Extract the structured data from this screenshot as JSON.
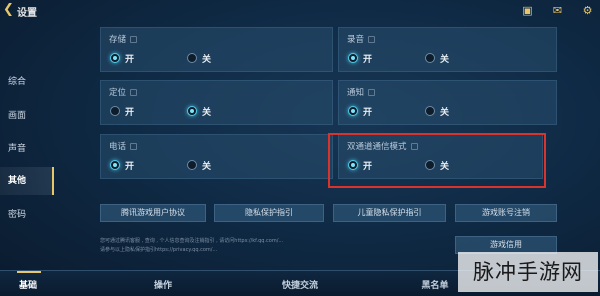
{
  "header": {
    "back_icon": "chevron-left-icon",
    "title": "设置",
    "right_icons": [
      "calendar-check-icon",
      "mail-icon",
      "gear-icon"
    ]
  },
  "nav": {
    "items": [
      {
        "label": "综合",
        "active": false
      },
      {
        "label": "画面",
        "active": false
      },
      {
        "label": "声音",
        "active": false
      },
      {
        "label": "其他",
        "active": true
      },
      {
        "label": "密码",
        "active": false
      }
    ]
  },
  "panels": [
    {
      "title": "存储",
      "on_label": "开",
      "off_label": "关",
      "selected": "on"
    },
    {
      "title": "录音",
      "on_label": "开",
      "off_label": "关",
      "selected": "on"
    },
    {
      "title": "定位",
      "on_label": "开",
      "off_label": "关",
      "selected": "off"
    },
    {
      "title": "通知",
      "on_label": "开",
      "off_label": "关",
      "selected": "on"
    },
    {
      "title": "电话",
      "on_label": "开",
      "off_label": "关",
      "selected": "on"
    },
    {
      "title": "双通道通信模式",
      "on_label": "开",
      "off_label": "关",
      "selected": "on"
    }
  ],
  "links": [
    "腾讯游戏用户协议",
    "隐私保护指引",
    "儿童隐私保护指引",
    "游戏账号注销"
  ],
  "notes": [
    "您可通过腾讯客服 , 查询 , 个人信息查询及注销指引 , 请访问https://kf.qq.com/...",
    "请参与以上隐私保护指引https://privacy.qq.com/..."
  ],
  "credit_label": "游戏信用",
  "tabs": [
    {
      "label": "基础",
      "active": true
    },
    {
      "label": "操作",
      "active": false
    },
    {
      "label": "快捷交流",
      "active": false
    },
    {
      "label": "黑名单",
      "active": false
    }
  ],
  "watermark": "脉冲手游网",
  "colors": {
    "accent": "#e8c66a",
    "radio_on": "#53c9e6",
    "highlight_box": "#d8332c"
  }
}
